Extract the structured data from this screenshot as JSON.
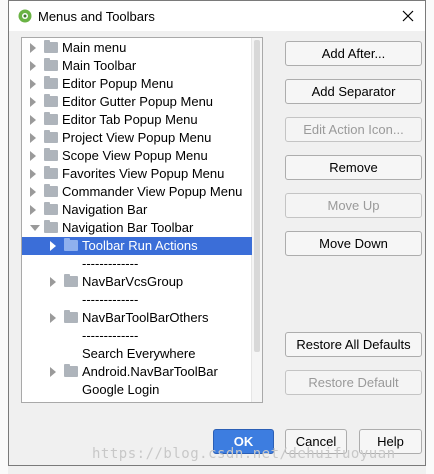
{
  "window": {
    "title": "Menus and Toolbars",
    "icon": "android-studio-icon",
    "close_icon": "close-icon"
  },
  "tree": {
    "items": [
      {
        "label": "Main menu",
        "expander": "collapsed",
        "folder": true,
        "level": 0
      },
      {
        "label": "Main Toolbar",
        "expander": "collapsed",
        "folder": true,
        "level": 0
      },
      {
        "label": "Editor Popup Menu",
        "expander": "collapsed",
        "folder": true,
        "level": 0
      },
      {
        "label": "Editor Gutter Popup Menu",
        "expander": "collapsed",
        "folder": true,
        "level": 0
      },
      {
        "label": "Editor Tab Popup Menu",
        "expander": "collapsed",
        "folder": true,
        "level": 0
      },
      {
        "label": "Project View Popup Menu",
        "expander": "collapsed",
        "folder": true,
        "level": 0
      },
      {
        "label": "Scope View Popup Menu",
        "expander": "collapsed",
        "folder": true,
        "level": 0
      },
      {
        "label": "Favorites View Popup Menu",
        "expander": "collapsed",
        "folder": true,
        "level": 0
      },
      {
        "label": "Commander View Popup Menu",
        "expander": "collapsed",
        "folder": true,
        "level": 0
      },
      {
        "label": "Navigation Bar",
        "expander": "collapsed",
        "folder": true,
        "level": 0
      },
      {
        "label": "Navigation Bar Toolbar",
        "expander": "expanded",
        "folder": true,
        "level": 0
      },
      {
        "label": "Toolbar Run Actions",
        "expander": "collapsed",
        "folder": true,
        "level": 1,
        "selected": true
      },
      {
        "label": "-------------",
        "expander": "none",
        "folder": false,
        "level": 1
      },
      {
        "label": "NavBarVcsGroup",
        "expander": "collapsed",
        "folder": true,
        "level": 1
      },
      {
        "label": "-------------",
        "expander": "none",
        "folder": false,
        "level": 1
      },
      {
        "label": "NavBarToolBarOthers",
        "expander": "collapsed",
        "folder": true,
        "level": 1
      },
      {
        "label": "-------------",
        "expander": "none",
        "folder": false,
        "level": 1
      },
      {
        "label": "Search Everywhere",
        "expander": "none",
        "folder": false,
        "level": 1
      },
      {
        "label": "Android.NavBarToolBar",
        "expander": "collapsed",
        "folder": true,
        "level": 1
      },
      {
        "label": "Google Login",
        "expander": "none",
        "folder": false,
        "level": 1
      }
    ]
  },
  "actions": {
    "add_after": "Add After...",
    "add_separator": "Add Separator",
    "edit_action_icon": "Edit Action Icon...",
    "remove": "Remove",
    "move_up": "Move Up",
    "move_down": "Move Down",
    "restore_all_defaults": "Restore All Defaults",
    "restore_default": "Restore Default"
  },
  "footer": {
    "ok": "OK",
    "cancel": "Cancel",
    "help": "Help"
  },
  "watermark": "https://blog.csdn.net/dehuifuoyuan",
  "colors": {
    "selection": "#3b6ed8",
    "ok_button": "#3d7de0"
  }
}
